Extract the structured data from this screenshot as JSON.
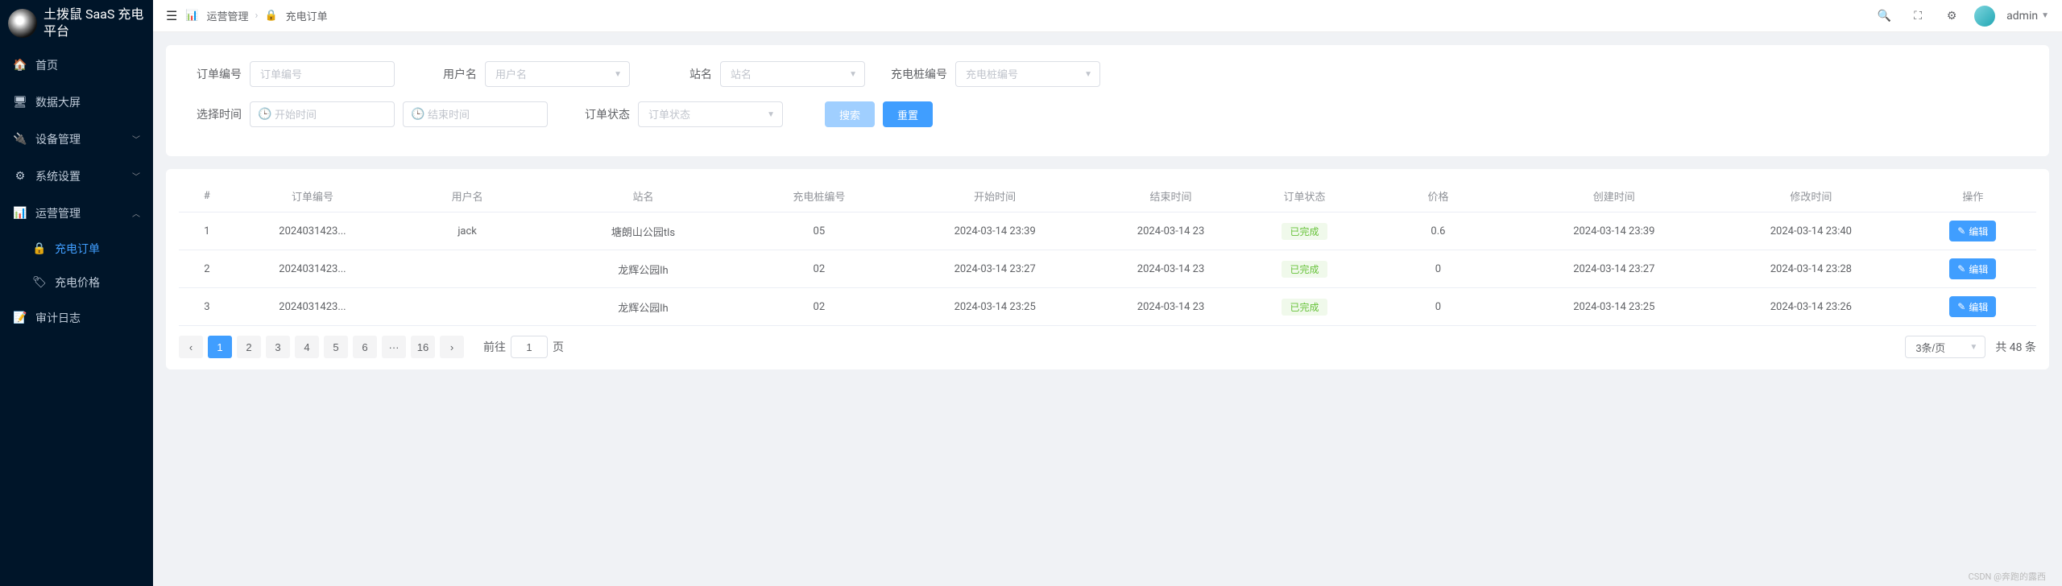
{
  "brand": {
    "title": "土拨鼠 SaaS 充电平台"
  },
  "sidebar": {
    "items": [
      {
        "icon": "🏠",
        "label": "首页"
      },
      {
        "icon": "🖥",
        "label": "数据大屏"
      },
      {
        "icon": "🔌",
        "label": "设备管理",
        "arrow": "﹀"
      },
      {
        "icon": "⚙",
        "label": "系统设置",
        "arrow": "﹀"
      },
      {
        "icon": "📊",
        "label": "运营管理",
        "arrow": "︿",
        "expanded": true,
        "children": [
          {
            "icon": "🔒",
            "label": "充电订单",
            "active": true
          },
          {
            "icon": "🏷",
            "label": "充电价格"
          }
        ]
      },
      {
        "icon": "📝",
        "label": "审计日志"
      }
    ]
  },
  "topbar": {
    "breadcrumb": {
      "parent": "运营管理",
      "current": "充电订单",
      "parent_icon": "📊",
      "current_icon": "🔒"
    },
    "user": "admin"
  },
  "search": {
    "order_label": "订单编号",
    "order_placeholder": "订单编号",
    "user_label": "用户名",
    "user_placeholder": "用户名",
    "station_label": "站名",
    "station_placeholder": "站名",
    "pile_label": "充电桩编号",
    "pile_placeholder": "充电桩编号",
    "time_label": "选择时间",
    "start_placeholder": "开始时间",
    "end_placeholder": "结束时间",
    "status_label": "订单状态",
    "status_placeholder": "订单状态",
    "search_btn": "搜索",
    "reset_btn": "重置"
  },
  "table": {
    "headers": {
      "idx": "#",
      "order": "订单编号",
      "user": "用户名",
      "station": "站名",
      "pile": "充电桩编号",
      "start": "开始时间",
      "end": "结束时间",
      "status": "订单状态",
      "price": "价格",
      "ctime": "创建时间",
      "mtime": "修改时间",
      "op": "操作"
    },
    "rows": [
      {
        "idx": "1",
        "order": "2024031423...",
        "user": "jack",
        "station": "塘朗山公园tls",
        "pile": "05",
        "start": "2024-03-14 23:39",
        "end": "2024-03-14 23",
        "status": "已完成",
        "price": "0.6",
        "ctime": "2024-03-14 23:39",
        "mtime": "2024-03-14 23:40"
      },
      {
        "idx": "2",
        "order": "2024031423...",
        "user": "",
        "station": "龙辉公园lh",
        "pile": "02",
        "start": "2024-03-14 23:27",
        "end": "2024-03-14 23",
        "status": "已完成",
        "price": "0",
        "ctime": "2024-03-14 23:27",
        "mtime": "2024-03-14 23:28"
      },
      {
        "idx": "3",
        "order": "2024031423...",
        "user": "",
        "station": "龙辉公园lh",
        "pile": "02",
        "start": "2024-03-14 23:25",
        "end": "2024-03-14 23",
        "status": "已完成",
        "price": "0",
        "ctime": "2024-03-14 23:25",
        "mtime": "2024-03-14 23:26"
      }
    ],
    "edit_label": "编辑"
  },
  "pagination": {
    "prev": "‹",
    "next": "›",
    "pages": [
      "1",
      "2",
      "3",
      "4",
      "5",
      "6",
      "···",
      "16"
    ],
    "active": "1",
    "jump_prefix": "前往",
    "jump_value": "1",
    "jump_suffix": "页",
    "size_label": "3条/页",
    "total_label": "共 48 条"
  },
  "watermark": "CSDN @奔跑的露西"
}
